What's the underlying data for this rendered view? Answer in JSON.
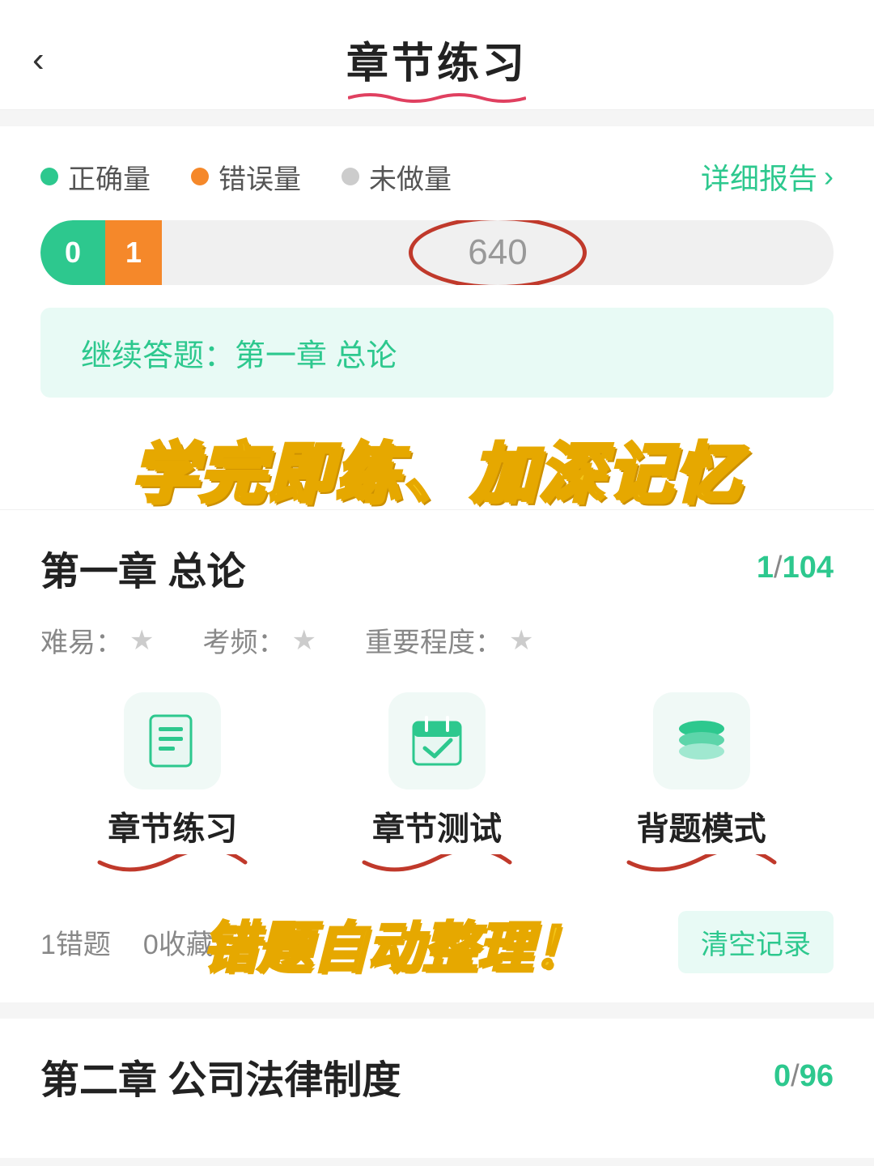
{
  "header": {
    "title": "章节练习",
    "back_label": "‹"
  },
  "legend": {
    "correct_label": "正确量",
    "error_label": "错误量",
    "undone_label": "未做量",
    "detail_report": "详细报告"
  },
  "progress": {
    "correct_count": "0",
    "error_count": "1",
    "remaining": "640"
  },
  "continue_banner": {
    "text": "继续答题：第一章 总论"
  },
  "promo": {
    "text": "学完即练、加深记忆"
  },
  "chapter1": {
    "title": "第一章 总论",
    "done": "1",
    "total": "104",
    "difficulty_label": "难易：",
    "frequency_label": "考频：",
    "importance_label": "重要程度：",
    "star": "★",
    "mode1_label": "章节练习",
    "mode2_label": "章节测试",
    "mode3_label": "背题模式",
    "error_count": "1错题",
    "bookmark_count": "0收藏",
    "clear_btn": "清空记录",
    "error_promo": "错题自动整理！"
  },
  "chapter2": {
    "title": "第二章 公司法律制度",
    "done": "0",
    "total": "96"
  }
}
